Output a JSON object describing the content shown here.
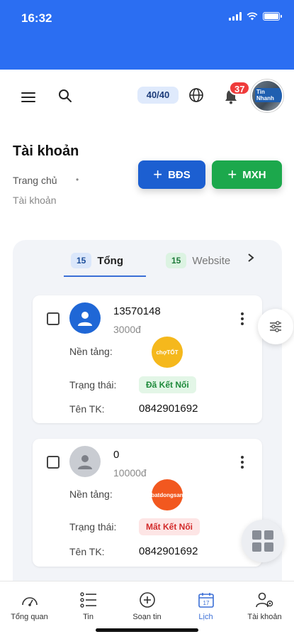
{
  "status_bar": {
    "time": "16:32"
  },
  "topbar": {
    "counter": "40/40",
    "notifications": "37",
    "avatar_brand": "Tin Nhanh"
  },
  "page": {
    "title": "Tài khoản",
    "breadcrumb_home": "Trang chủ",
    "breadcrumb_dot": "•",
    "breadcrumb_current": "Tài khoản"
  },
  "actions": {
    "bds_label": "BĐS",
    "mxh_label": "MXH",
    "plus": "+"
  },
  "tabs": [
    {
      "count": "15",
      "label": "Tổng"
    },
    {
      "count": "15",
      "label": "Website"
    }
  ],
  "labels": {
    "platform": "Nền tảng:",
    "status": "Trạng thái:",
    "account_name": "Tên TK:"
  },
  "accounts": [
    {
      "name": "13570148",
      "price": "3000đ",
      "platform_logo": "chợTỐT",
      "status": "Đã Kết Nối",
      "username": "0842901692"
    },
    {
      "name": "0",
      "price": "10000đ",
      "platform_logo": "batdongsan",
      "status": "Mất Kết Nối",
      "username": "0842901692"
    }
  ],
  "bottom_nav": [
    {
      "label": "Tổng quan",
      "icon": "gauge-icon"
    },
    {
      "label": "Tin",
      "icon": "list-icon"
    },
    {
      "label": "Soạn tin",
      "icon": "add-circle-icon"
    },
    {
      "label": "Lịch",
      "icon": "calendar-icon"
    },
    {
      "label": "Tài khoản",
      "icon": "user-settings-icon"
    }
  ],
  "calendar_day": "17",
  "colors": {
    "primary": "#2b6ef2",
    "bds_button": "#1c5fd1",
    "mxh_button": "#1ca84c",
    "connected": "#1d8a3a",
    "disconnected": "#d22a2a"
  }
}
